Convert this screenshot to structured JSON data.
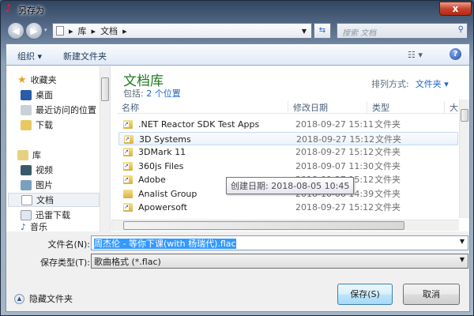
{
  "window": {
    "title": "另存为",
    "close": "x"
  },
  "address": {
    "crumbs": [
      "库",
      "文档"
    ],
    "search_placeholder": "搜索 文档"
  },
  "toolbar": {
    "organize": "组织 ▾",
    "new_folder": "新建文件夹",
    "view": "☷ ▾",
    "help": "?"
  },
  "nav": {
    "favorites": "收藏夹",
    "items": [
      {
        "label": "桌面"
      },
      {
        "label": "最近访问的位置"
      },
      {
        "label": "下载"
      }
    ],
    "library": "库",
    "lib_items": [
      {
        "label": "视频"
      },
      {
        "label": "图片"
      },
      {
        "label": "文档",
        "selected": true
      },
      {
        "label": "迅雷下载"
      },
      {
        "label": "音乐"
      }
    ]
  },
  "main": {
    "title": "文档库",
    "includes_label": "包括:",
    "includes_link": "2 个位置",
    "sort_label": "排列方式:",
    "sort_value": "文件夹 ▾",
    "columns": [
      "名称",
      "修改日期",
      "类型",
      "大"
    ],
    "rows": [
      {
        "name": ".NET Reactor SDK Test Apps",
        "date": "2018-09-27 15:11",
        "type": "文件夹",
        "shortcut": true
      },
      {
        "name": "3D Systems",
        "date": "2018-09-27 15:12",
        "type": "文件夹",
        "shortcut": true
      },
      {
        "name": "3DMark 11",
        "date": "2018-09-27 15:12",
        "type": "文件夹",
        "shortcut": true
      },
      {
        "name": "360js Files",
        "date": "2018-09-07 11:30",
        "type": "文件夹",
        "shortcut": true
      },
      {
        "name": "Adobe",
        "date": "2018-09-27 15:12",
        "type": "文件夹",
        "shortcut": true
      },
      {
        "name": "Analist Group",
        "date": "2018-10-06 14:39",
        "type": "文件夹",
        "shortcut": false
      },
      {
        "name": "Apowersoft",
        "date": "2018-09-27 15:12",
        "type": "文件夹",
        "shortcut": true
      }
    ],
    "tooltip": "创建日期: 2018-08-05 10:45"
  },
  "form": {
    "filename_label": "文件名(N):",
    "filename_value": "周杰伦 - 等你下课(with 杨瑞代).flac",
    "type_label": "保存类型(T):",
    "type_value": "歌曲格式 (*.flac)"
  },
  "footer": {
    "hide_folders": "隐藏文件夹",
    "save": "保存(S)",
    "cancel": "取消"
  }
}
